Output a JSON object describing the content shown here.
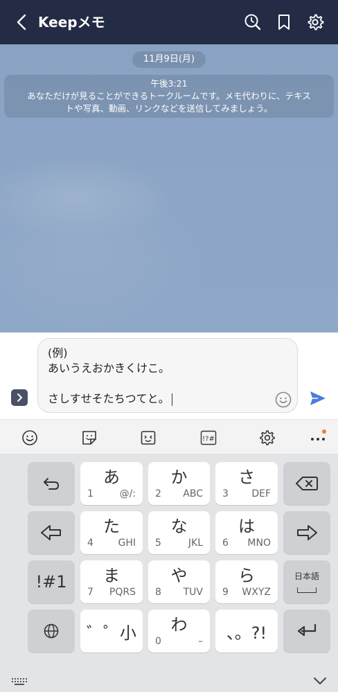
{
  "header": {
    "title": "Keepメモ",
    "bg_color": "#232b45"
  },
  "chat": {
    "date": "11月9日(月)",
    "system_message": {
      "time": "午後3:21",
      "line1": "あなただけが見ることができるトークルームです。メモ代わりに、テキス",
      "line2": "トや写真、動画、リンクなどを送信してみましょう。"
    }
  },
  "input": {
    "line1": "(例)",
    "line2": "あいうえおかきくけこ。",
    "line3": "",
    "line4": "さしすせそたちつてと。",
    "send_color": "#4a7dd8"
  },
  "toolbar": {
    "icons": [
      "emoji-icon",
      "sticker-icon",
      "kaomoji-icon",
      "symbol-icon",
      "settings-icon",
      "more-icon"
    ],
    "symbol_label": "!?#",
    "notification_color": "#f07b2a"
  },
  "keyboard": {
    "row1": {
      "k1": {
        "main": "あ",
        "num": "1",
        "sub": "@/:"
      },
      "k2": {
        "main": "か",
        "num": "2",
        "sub": "ABC"
      },
      "k3": {
        "main": "さ",
        "num": "3",
        "sub": "DEF"
      }
    },
    "row2": {
      "k1": {
        "main": "た",
        "num": "4",
        "sub": "GHI"
      },
      "k2": {
        "main": "な",
        "num": "5",
        "sub": "JKL"
      },
      "k3": {
        "main": "は",
        "num": "6",
        "sub": "MNO"
      }
    },
    "row3": {
      "left": "!#1",
      "k1": {
        "main": "ま",
        "num": "7",
        "sub": "PQRS"
      },
      "k2": {
        "main": "や",
        "num": "8",
        "sub": "TUV"
      },
      "k3": {
        "main": "ら",
        "num": "9",
        "sub": "WXYZ"
      },
      "lang": "日本語"
    },
    "row4": {
      "dakuten": "゛゜小",
      "k2": {
        "main": "わ",
        "num": "0",
        "sub": "–"
      },
      "punct": "、。?!"
    }
  }
}
